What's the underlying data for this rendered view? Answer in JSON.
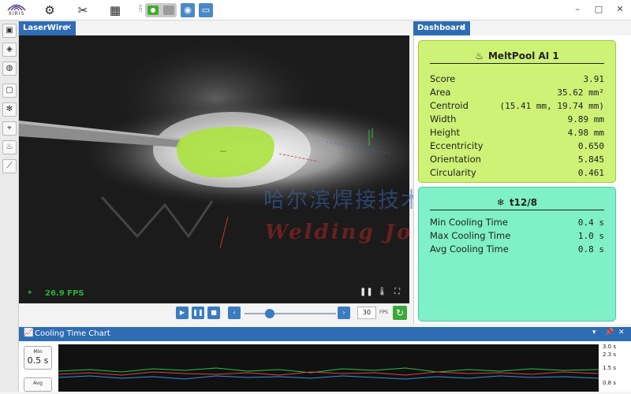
{
  "app": {
    "logo_text": "XIRIS",
    "rec_label": "REC"
  },
  "window": {
    "minimize": "–",
    "maximize": "□",
    "close": "✕"
  },
  "video_panel": {
    "tab_label": "LaserWire",
    "tab_close": "✕",
    "fps_text": "26.9 FPS",
    "fps_value": "30",
    "fps_unit": "FPS"
  },
  "dashboard": {
    "tab_label": "Dashboard",
    "tab_close": "✕",
    "meltpool": {
      "title": "MeltPool AI 1",
      "rows": [
        {
          "label": "Score",
          "value": "3.91"
        },
        {
          "label": "Area",
          "value": "35.62 mm²"
        },
        {
          "label": "Centroid",
          "value": "(15.41 mm, 19.74 mm)"
        },
        {
          "label": "Width",
          "value": "9.89 mm"
        },
        {
          "label": "Height",
          "value": "4.98 mm"
        },
        {
          "label": "Eccentricity",
          "value": "0.650"
        },
        {
          "label": "Orientation",
          "value": "5.845"
        },
        {
          "label": "Circularity",
          "value": "0.461"
        }
      ]
    },
    "cooling": {
      "title": "t12/8",
      "rows": [
        {
          "label": "Min Cooling Time",
          "value": "0.4 s"
        },
        {
          "label": "Max Cooling Time",
          "value": "1.0 s"
        },
        {
          "label": "Avg Cooling Time",
          "value": "0.8 s"
        }
      ]
    }
  },
  "chart_panel": {
    "title": "Cooling Time Chart",
    "min_label": "Min",
    "min_value": "0.5 s",
    "avg_label": "Avg",
    "yticks": [
      "3.0 s",
      "2.3 s",
      "1.5 s",
      "0.8 s"
    ]
  },
  "watermark": {
    "cn": "哈尔滨焊接技术",
    "en": "Welding Joining"
  },
  "colors": {
    "tab_blue": "#2e6db3",
    "meltpool_card": "#cdf276",
    "cooling_card": "#7ff0c8",
    "fps_green": "#2fae3a"
  }
}
